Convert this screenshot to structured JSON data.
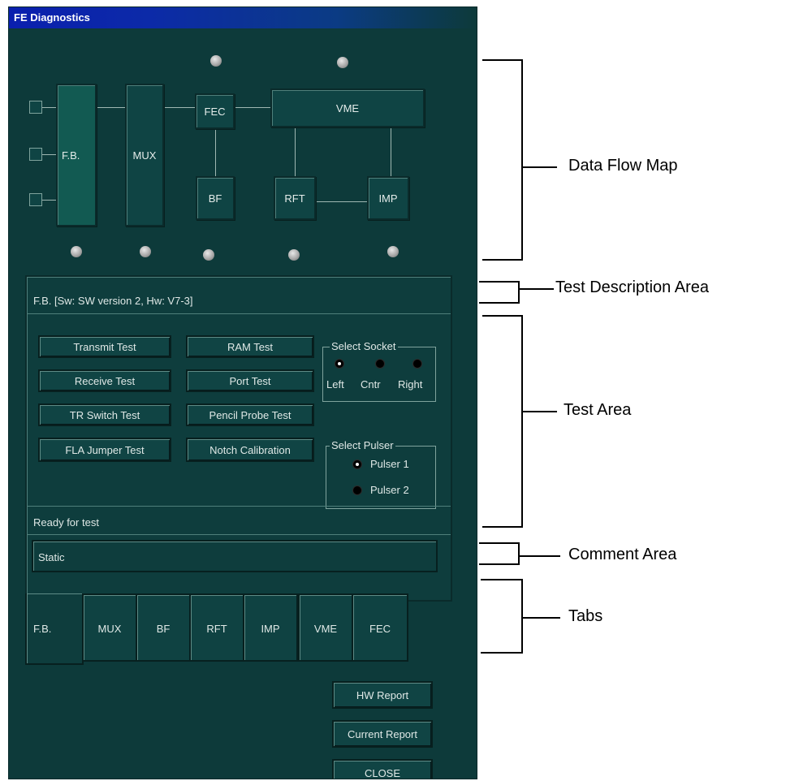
{
  "window": {
    "title": "FE Diagnostics"
  },
  "map": {
    "fb": "F.B.",
    "mux": "MUX",
    "fec": "FEC",
    "vme": "VME",
    "bf": "BF",
    "rft": "RFT",
    "imp": "IMP"
  },
  "description": "F.B. [Sw: SW version 2, Hw: V7-3]",
  "tests": {
    "left": [
      "Transmit Test",
      "Receive Test",
      "TR Switch Test",
      "FLA Jumper Test"
    ],
    "right": [
      "RAM Test",
      "Port Test",
      "Pencil Probe Test",
      "Notch  Calibration"
    ]
  },
  "socket": {
    "title": "Select Socket",
    "options": [
      "Left",
      "Cntr",
      "Right"
    ],
    "selected": "Left"
  },
  "pulser": {
    "title": "Select Pulser",
    "options": [
      "Pulser 1",
      "Pulser 2"
    ],
    "selected": "Pulser 1"
  },
  "status": "Ready for test",
  "comment": "Static",
  "tabs": [
    "F.B.",
    "MUX",
    "BF",
    "RFT",
    "IMP",
    "VME",
    "FEC"
  ],
  "active_tab": "F.B.",
  "buttons": {
    "hw_report": "HW Report",
    "current_report": "Current Report",
    "close": "CLOSE"
  },
  "annotations": [
    "Data Flow Map",
    "Test Description Area",
    "Test Area",
    "Comment Area",
    "Tabs"
  ],
  "colors": {
    "background": "#0d3a3a",
    "titlebar": "#0a1fae",
    "text": "#dfe8e6"
  }
}
